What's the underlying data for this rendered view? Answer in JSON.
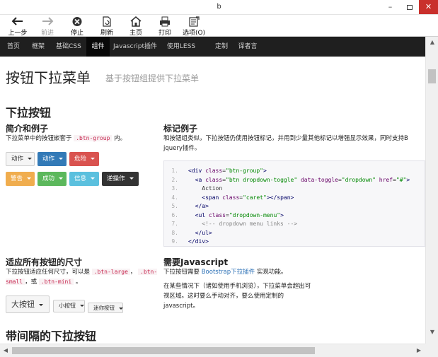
{
  "window": {
    "title": "b"
  },
  "toolbar": {
    "back": "上一步",
    "forward": "前进",
    "stop": "停止",
    "refresh": "刷新",
    "home": "主页",
    "print": "打印",
    "options": "选项(O)"
  },
  "nav": {
    "items": [
      {
        "label": "首页"
      },
      {
        "label": "框架"
      },
      {
        "label": "基础CSS"
      },
      {
        "label": "组件"
      },
      {
        "label": "Javascript插件"
      },
      {
        "label": "使用LESS"
      },
      {
        "label": "定制"
      },
      {
        "label": "译者言"
      }
    ],
    "active_index": 3
  },
  "page": {
    "title": "按钮下拉菜单",
    "subtitle": "基于按钮组提供下拉菜单",
    "section1_title": "下拉按钮",
    "intro": {
      "title": "简介和例子",
      "text_before": "下拉菜单中的按钮嵌套于",
      "code": ".btn-group",
      "text_after": "内。"
    },
    "buttons_row1": [
      "动作",
      "动作",
      "危险"
    ],
    "buttons_row2": [
      "警告",
      "成功",
      "信息",
      "逆操作"
    ],
    "markup": {
      "title": "标记例子",
      "text1": "和按钮组类似，下拉按钮仍使用按钮标记，并用到少量其他标记以增强显示效果，同时支持B",
      "text2": "jquery插件。"
    },
    "code_lines": [
      {
        "n": "1.",
        "tokens": [
          {
            "t": "tag",
            "v": "<div "
          },
          {
            "t": "attr",
            "v": "class"
          },
          {
            "t": "plain",
            "v": "="
          },
          {
            "t": "str",
            "v": "\"btn-group\""
          },
          {
            "t": "tag",
            "v": ">"
          }
        ]
      },
      {
        "n": "2.",
        "tokens": [
          {
            "t": "tag",
            "v": "  <a "
          },
          {
            "t": "attr",
            "v": "class"
          },
          {
            "t": "plain",
            "v": "="
          },
          {
            "t": "str",
            "v": "\"btn dropdown-toggle\""
          },
          {
            "t": "attr",
            "v": " data-toggle"
          },
          {
            "t": "plain",
            "v": "="
          },
          {
            "t": "str",
            "v": "\"dropdown\""
          },
          {
            "t": "attr",
            "v": " href"
          },
          {
            "t": "plain",
            "v": "="
          },
          {
            "t": "str",
            "v": "\"#\""
          },
          {
            "t": "tag",
            "v": ">"
          }
        ]
      },
      {
        "n": "3.",
        "tokens": [
          {
            "t": "plain",
            "v": "    Action"
          }
        ]
      },
      {
        "n": "4.",
        "tokens": [
          {
            "t": "tag",
            "v": "    <span "
          },
          {
            "t": "attr",
            "v": "class"
          },
          {
            "t": "plain",
            "v": "="
          },
          {
            "t": "str",
            "v": "\"caret\""
          },
          {
            "t": "tag",
            "v": "></span>"
          }
        ]
      },
      {
        "n": "5.",
        "tokens": [
          {
            "t": "tag",
            "v": "  </a>"
          }
        ]
      },
      {
        "n": "6.",
        "tokens": [
          {
            "t": "tag",
            "v": "  <ul "
          },
          {
            "t": "attr",
            "v": "class"
          },
          {
            "t": "plain",
            "v": "="
          },
          {
            "t": "str",
            "v": "\"dropdown-menu\""
          },
          {
            "t": "tag",
            "v": ">"
          }
        ]
      },
      {
        "n": "7.",
        "tokens": [
          {
            "t": "cmt",
            "v": "    <!-- dropdown menu links -->"
          }
        ]
      },
      {
        "n": "8.",
        "tokens": [
          {
            "t": "tag",
            "v": "  </ul>"
          }
        ]
      },
      {
        "n": "9.",
        "tokens": [
          {
            "t": "tag",
            "v": "</div>"
          }
        ]
      }
    ],
    "sizes": {
      "title": "适应所有按钮的尺寸",
      "text1": "下拉按钮适应任何尺寸，可以是",
      "code_large": ".btn-large",
      "sep1": "，",
      "code_small": ".btn-small",
      "sep2": "，或",
      "code_mini": ".btn-mini",
      "end": "。"
    },
    "size_buttons": [
      "大按钮",
      "小按钮",
      "迷你按钮"
    ],
    "js": {
      "title": "需要Javascript",
      "text_before": "下拉按钮需要",
      "link": "Bootstrap下拉插件",
      "text_after": "实现功能。",
      "p2": "在某些情况下（诸如使用手机浏览），下拉菜单会超出可视区域。这时要么手动对齐，要么使用定制的javascript。"
    },
    "section2_title": "带间隔的下拉按钮"
  }
}
